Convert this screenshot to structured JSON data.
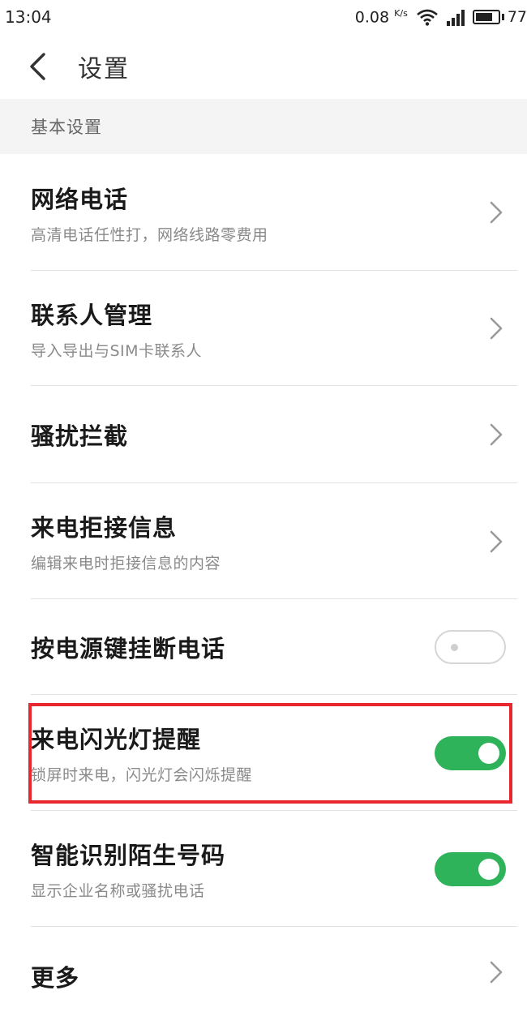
{
  "status_bar": {
    "time": "13:04",
    "net_speed": "0.08",
    "net_speed_unit": "K/s",
    "battery": "77"
  },
  "header": {
    "title": "设置"
  },
  "section": {
    "title": "基本设置"
  },
  "items": [
    {
      "title": "网络电话",
      "subtitle": "高清电话任性打，网络线路零费用",
      "control": "chevron"
    },
    {
      "title": "联系人管理",
      "subtitle": "导入导出与SIM卡联系人",
      "control": "chevron"
    },
    {
      "title": "骚扰拦截",
      "subtitle": "",
      "control": "chevron"
    },
    {
      "title": "来电拒接信息",
      "subtitle": "编辑来电时拒接信息的内容",
      "control": "chevron"
    },
    {
      "title": "按电源键挂断电话",
      "subtitle": "",
      "control": "toggle",
      "on": false
    },
    {
      "title": "来电闪光灯提醒",
      "subtitle": "锁屏时来电，闪光灯会闪烁提醒",
      "control": "toggle",
      "on": true
    },
    {
      "title": "智能识别陌生号码",
      "subtitle": "显示企业名称或骚扰电话",
      "control": "toggle",
      "on": true
    },
    {
      "title": "更多",
      "subtitle": "",
      "control": "chevron"
    }
  ],
  "colors": {
    "toggle_on": "#2fb35a",
    "highlight": "#e8282e"
  }
}
